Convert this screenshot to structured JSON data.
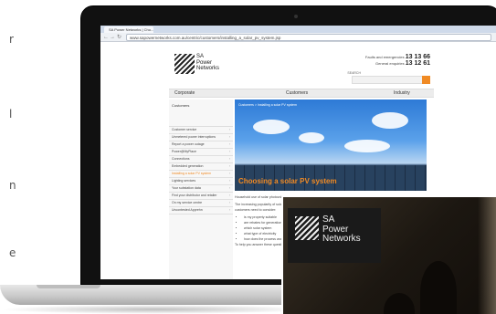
{
  "left_text": {
    "chars": [
      "r",
      "l",
      "n",
      "e"
    ]
  },
  "browser": {
    "tab_title": "SA Power Networks | Cho...",
    "url": "www.sapowernetworks.com.au/centric/customers/installing_a_solar_pv_system.jsp",
    "back_icon": "arrow-left-icon",
    "forward_icon": "arrow-right-icon",
    "reload_icon": "reload-icon"
  },
  "site": {
    "logo_lines": [
      "SA",
      "Power",
      "Networks"
    ],
    "contact": {
      "faults_label": "Faults and emergencies",
      "faults_number": "13 13 66",
      "general_label": "General enquiries",
      "general_number": "13 12 61"
    },
    "search_label": "SEARCH",
    "nav": [
      "Corporate",
      "Customers",
      "Industry"
    ],
    "sidebar_heading": "Customers",
    "sidebar_items": [
      "Customer service",
      "Unmetered power interruptions",
      "Report a power outage",
      "Power@MyPlace",
      "Connections",
      "Embedded generation",
      "Installing a solar PV system",
      "Lighting services",
      "Your substation data",
      "Find your distributor and retailer",
      "On my service centre",
      "Uncontested Apprehn"
    ],
    "active_sidebar_index": 6,
    "hero_label": "Customers > Installing a solar PV system",
    "hero_title": "Choosing a solar PV system",
    "body": {
      "intro": "Household use of solar photovoltaic",
      "para": "The increasing popularity of solar PV systems means more energy is exported from solar power to help a more sustainable system. customers need to consider:",
      "bullets": [
        "is my property suitable",
        "are rebates for generation",
        "which solar system",
        "what type of electricity",
        "how does the process work"
      ],
      "closing": "To help you answer these questions, this page explains how solar power systems work"
    }
  },
  "photo": {
    "logo_lines": [
      "SA",
      "Power",
      "Networks"
    ]
  },
  "colors": {
    "accent": "#f08a24",
    "laptop_bezel": "#111111"
  }
}
